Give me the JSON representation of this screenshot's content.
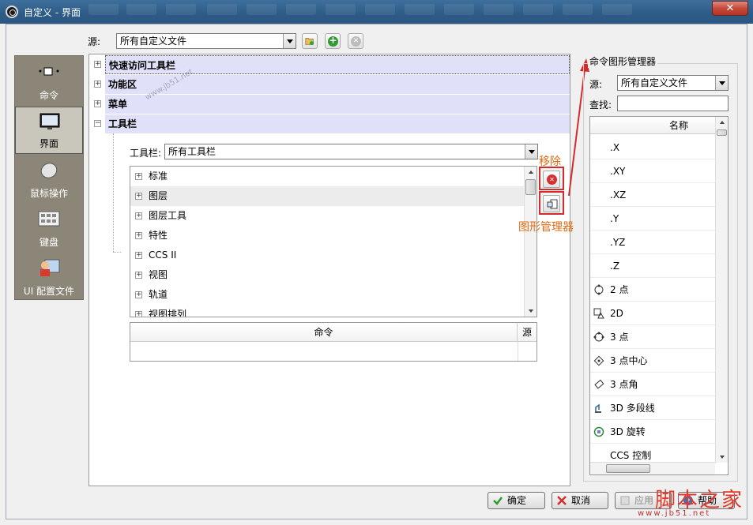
{
  "window": {
    "title": "自定义 - 界面",
    "close_label": "✕"
  },
  "source": {
    "label": "源:",
    "value": "所有自定义文件"
  },
  "left_nav": [
    {
      "label": "命令",
      "icon": "command-icon",
      "selected": false
    },
    {
      "label": "界面",
      "icon": "monitor-icon",
      "selected": true
    },
    {
      "label": "鼠标操作",
      "icon": "mouse-icon",
      "selected": false
    },
    {
      "label": "键盘",
      "icon": "keyboard-icon",
      "selected": false
    },
    {
      "label": "UI 配置文件",
      "icon": "ui-profile-icon",
      "selected": false
    }
  ],
  "tree": [
    {
      "label": "快速访问工具栏",
      "expander": "+"
    },
    {
      "label": "功能区",
      "expander": "+"
    },
    {
      "label": "菜单",
      "expander": "+"
    },
    {
      "label": "工具栏",
      "expander": "−"
    }
  ],
  "toolbar_select": {
    "label": "工具栏:",
    "value": "所有工具栏"
  },
  "toolbar_list": [
    "标准",
    "图层",
    "图层工具",
    "特性",
    "CCS II",
    "视图",
    "轨道",
    "视图排列"
  ],
  "command_grid": {
    "col_command": "命令",
    "col_source": "源"
  },
  "annotations": {
    "remove_label": "移除",
    "manager_label": "图形管理器"
  },
  "right_panel": {
    "title": "命令图形管理器",
    "source_label": "源:",
    "source_value": "所有自定义文件",
    "search_label": "查找:",
    "search_value": "",
    "column_header": "名称",
    "items": [
      {
        "label": ".X",
        "icon": ""
      },
      {
        "label": ".XY",
        "icon": ""
      },
      {
        "label": ".XZ",
        "icon": ""
      },
      {
        "label": ".Y",
        "icon": ""
      },
      {
        "label": ".YZ",
        "icon": ""
      },
      {
        "label": ".Z",
        "icon": ""
      },
      {
        "label": "2 点",
        "icon": "circle-2point-icon"
      },
      {
        "label": "2D",
        "icon": "2d-icon"
      },
      {
        "label": "3 点",
        "icon": "circle-3point-icon"
      },
      {
        "label": "3 点中心",
        "icon": "center-3point-icon"
      },
      {
        "label": "3 点角",
        "icon": "angle-3point-icon"
      },
      {
        "label": "3D 多段线",
        "icon": "polyline-3d-icon"
      },
      {
        "label": "3D 旋转",
        "icon": "rotate-3d-icon"
      },
      {
        "label": "CCS 控制",
        "icon": ""
      }
    ]
  },
  "buttons": {
    "ok": "确定",
    "cancel": "取消",
    "apply": "应用",
    "help": "帮助"
  },
  "watermark": {
    "main": "脚本之家",
    "url": "www.jb51.net"
  },
  "colors": {
    "titlebar": "#2c5b86",
    "tree_highlight": "#e0e0f8",
    "annotation_red": "#d62a2a",
    "annotation_orange": "#e06a12",
    "nav_background": "#8b8678"
  }
}
